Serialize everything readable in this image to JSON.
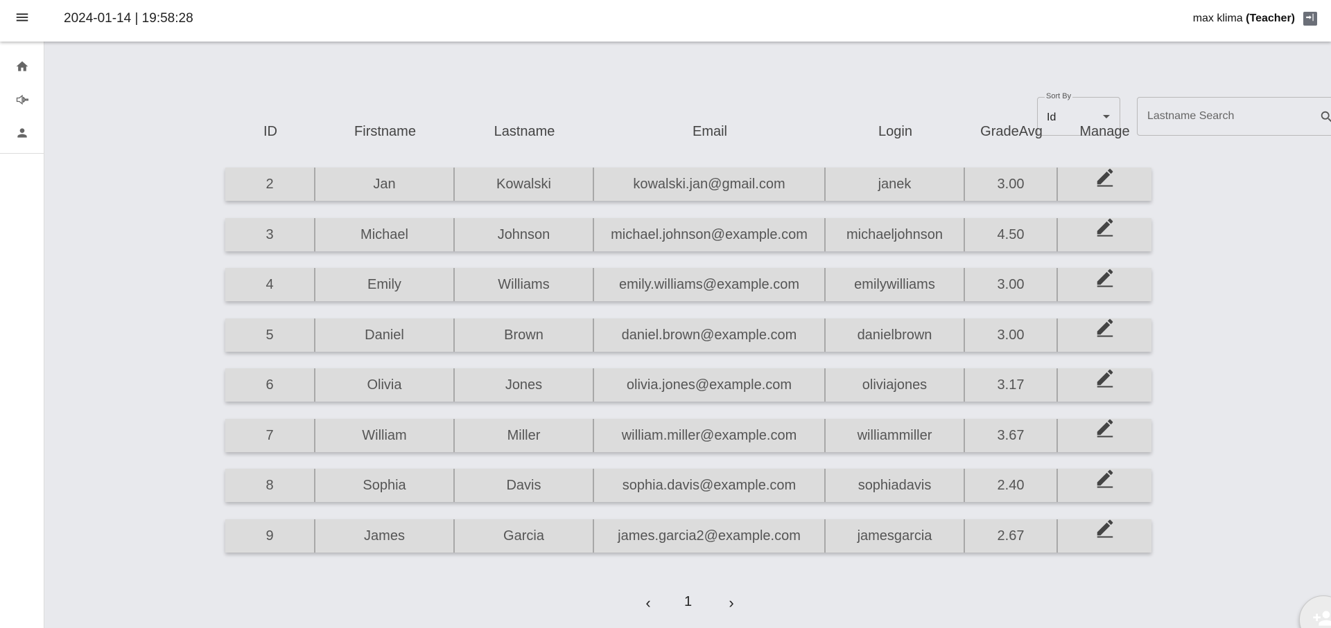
{
  "header": {
    "datetime": "2024-01-14 | 19:58:28",
    "user_name": "max klima",
    "user_role": "(Teacher)"
  },
  "sidebar": {
    "items": [
      {
        "name": "home",
        "icon": "home-icon"
      },
      {
        "name": "announcements",
        "icon": "megaphone-icon"
      },
      {
        "name": "profile",
        "icon": "person-icon"
      }
    ]
  },
  "controls": {
    "sort_label": "Sort By",
    "sort_value": "Id",
    "search_placeholder": "Lastname Search"
  },
  "table": {
    "headers": [
      "ID",
      "Firstname",
      "Lastname",
      "Email",
      "Login",
      "GradeAvg",
      "Manage"
    ],
    "rows": [
      {
        "id": "2",
        "firstname": "Jan",
        "lastname": "Kowalski",
        "email": "kowalski.jan@gmail.com",
        "login": "janek",
        "grade": "3.00"
      },
      {
        "id": "3",
        "firstname": "Michael",
        "lastname": "Johnson",
        "email": "michael.johnson@example.com",
        "login": "michaeljohnson",
        "grade": "4.50"
      },
      {
        "id": "4",
        "firstname": "Emily",
        "lastname": "Williams",
        "email": "emily.williams@example.com",
        "login": "emilywilliams",
        "grade": "3.00"
      },
      {
        "id": "5",
        "firstname": "Daniel",
        "lastname": "Brown",
        "email": "daniel.brown@example.com",
        "login": "danielbrown",
        "grade": "3.00"
      },
      {
        "id": "6",
        "firstname": "Olivia",
        "lastname": "Jones",
        "email": "olivia.jones@example.com",
        "login": "oliviajones",
        "grade": "3.17"
      },
      {
        "id": "7",
        "firstname": "William",
        "lastname": "Miller",
        "email": "william.miller@example.com",
        "login": "williammiller",
        "grade": "3.67"
      },
      {
        "id": "8",
        "firstname": "Sophia",
        "lastname": "Davis",
        "email": "sophia.davis@example.com",
        "login": "sophiadavis",
        "grade": "2.40"
      },
      {
        "id": "9",
        "firstname": "James",
        "lastname": "Garcia",
        "email": "james.garcia2@example.com",
        "login": "jamesgarcia",
        "grade": "2.67"
      }
    ]
  },
  "pagination": {
    "prev": "‹",
    "current": "1",
    "next": "›"
  },
  "fab": {
    "icon": "add-person-icon"
  }
}
